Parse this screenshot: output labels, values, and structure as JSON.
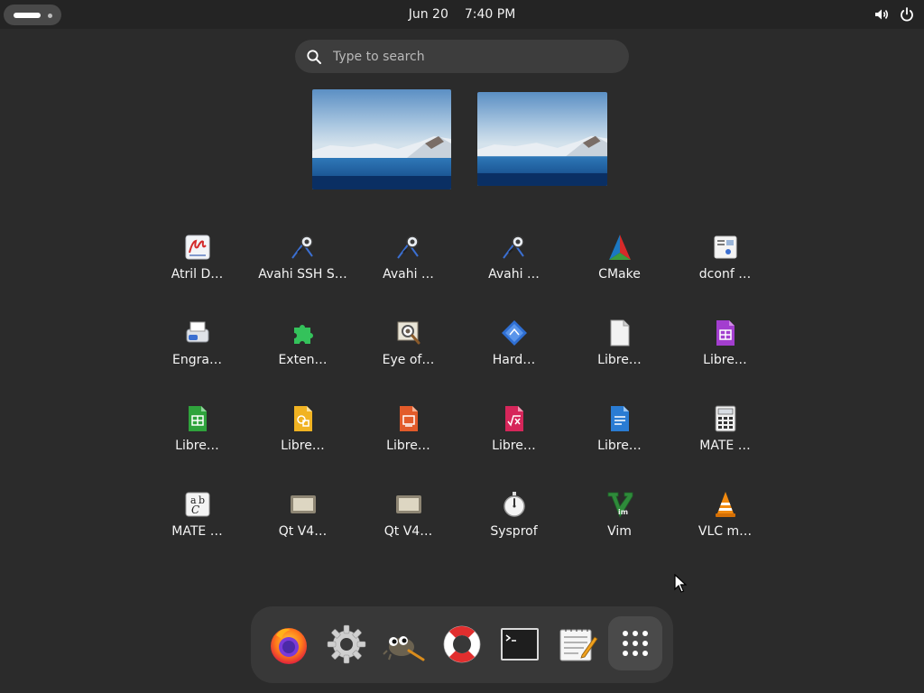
{
  "topbar": {
    "date": "Jun 20",
    "time": "7:40 PM",
    "activities_icon": "activities-pill-icon",
    "tray_icons": [
      "volume-icon",
      "power-icon"
    ]
  },
  "search": {
    "placeholder": "Type to search",
    "value": "",
    "icon": "search-icon"
  },
  "workspaces": [
    {
      "name": "workspace-1",
      "active": true
    },
    {
      "name": "workspace-2",
      "active": false
    }
  ],
  "apps": [
    {
      "label": "Atril D…",
      "icon": "atril-document-viewer-icon"
    },
    {
      "label": "Avahi SSH S…",
      "icon": "avahi-ssh-browser-icon"
    },
    {
      "label": "Avahi …",
      "icon": "avahi-discovery-icon"
    },
    {
      "label": "Avahi …",
      "icon": "avahi-vnc-browser-icon"
    },
    {
      "label": "CMake",
      "icon": "cmake-icon"
    },
    {
      "label": "dconf …",
      "icon": "dconf-editor-icon"
    },
    {
      "label": "Engra…",
      "icon": "engrampa-archive-icon"
    },
    {
      "label": "Exten…",
      "icon": "extensions-icon"
    },
    {
      "label": "Eye of…",
      "icon": "eye-of-mate-icon"
    },
    {
      "label": "Hard…",
      "icon": "hardinfo-icon"
    },
    {
      "label": "Libre…",
      "icon": "libreoffice-icon"
    },
    {
      "label": "Libre…",
      "icon": "libreoffice-base-icon"
    },
    {
      "label": "Libre…",
      "icon": "libreoffice-calc-icon"
    },
    {
      "label": "Libre…",
      "icon": "libreoffice-draw-icon"
    },
    {
      "label": "Libre…",
      "icon": "libreoffice-impress-icon"
    },
    {
      "label": "Libre…",
      "icon": "libreoffice-math-icon"
    },
    {
      "label": "Libre…",
      "icon": "libreoffice-writer-icon"
    },
    {
      "label": "MATE …",
      "icon": "mate-calculator-icon"
    },
    {
      "label": "MATE …",
      "icon": "mate-character-map-icon"
    },
    {
      "label": "Qt V4…",
      "icon": "qt-v4l2-icon"
    },
    {
      "label": "Qt V4…",
      "icon": "qt-v4l2-test-icon"
    },
    {
      "label": "Sysprof",
      "icon": "sysprof-icon"
    },
    {
      "label": "Vim",
      "icon": "vim-icon"
    },
    {
      "label": "VLC m…",
      "icon": "vlc-media-player-icon"
    }
  ],
  "dock": {
    "items": [
      {
        "name": "firefox",
        "icon": "firefox-icon"
      },
      {
        "name": "settings",
        "icon": "gear-icon"
      },
      {
        "name": "gimp",
        "icon": "gimp-icon"
      },
      {
        "name": "help",
        "icon": "lifebuoy-icon"
      },
      {
        "name": "terminal",
        "icon": "terminal-icon"
      },
      {
        "name": "text-editor",
        "icon": "text-editor-icon"
      },
      {
        "name": "show-apps",
        "icon": "app-grid-icon"
      }
    ]
  },
  "colors": {
    "background": "#2b2b2b",
    "topbar": "#242424",
    "search_bg": "#3d3d3d",
    "dock_bg": "#383838"
  }
}
